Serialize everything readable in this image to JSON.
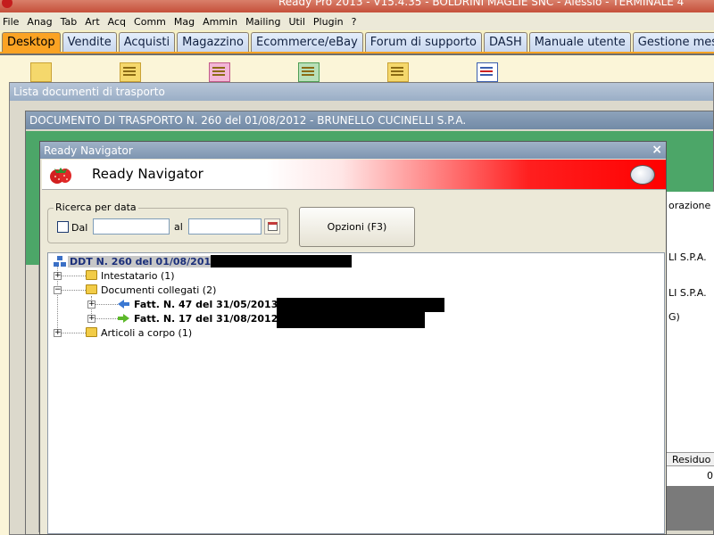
{
  "app": {
    "title": "Ready Pro 2013 - V15.4.35 - BOLDRINI MAGLIE SNC - Alessio - TERMINALE 4"
  },
  "menu": [
    "File",
    "Anag",
    "Tab",
    "Art",
    "Acq",
    "Comm",
    "Mag",
    "Ammin",
    "Mailing",
    "Util",
    "Plugin",
    "?"
  ],
  "tabs": [
    "Desktop",
    "Vendite",
    "Acquisti",
    "Magazzino",
    "Ecommerce/eBay",
    "Forum di supporto",
    "DASH",
    "Manuale utente",
    "Gestione messa"
  ],
  "windows": {
    "lista": {
      "title": "Lista documenti di trasporto"
    },
    "documento": {
      "title": "DOCUMENTO DI TRASPORTO N. 260 del 01/08/2012 - BRUNELLO CUCINELLI S.P.A.",
      "right_texts": [
        "orazione",
        "LI S.P.A.",
        "LI S.P.A.",
        "G)",
        "Residuo",
        "0"
      ]
    },
    "navigator": {
      "title": "Ready Navigator",
      "banner_title": "Ready Navigator"
    }
  },
  "search": {
    "legend": "Ricerca per data",
    "dal_label": "Dal",
    "dal_value": "",
    "al_label": "al",
    "al_value": ""
  },
  "buttons": {
    "opzioni": "Opzioni (F3)"
  },
  "tree": {
    "root": "DDT N. 260 del 01/08/2012 -",
    "intestatario": "Intestatario (1)",
    "collegati": "Documenti collegati (2)",
    "fatt1": "Fatt. N. 47 del 31/05/2013 -",
    "fatt2": "Fatt. N. 17 del 31/08/2012 -",
    "articoli": "Articoli a corpo (1)"
  },
  "colors": {
    "accent_tab": "#fba323",
    "green_panel": "#4ca668",
    "banner_red": "#ff0000"
  }
}
